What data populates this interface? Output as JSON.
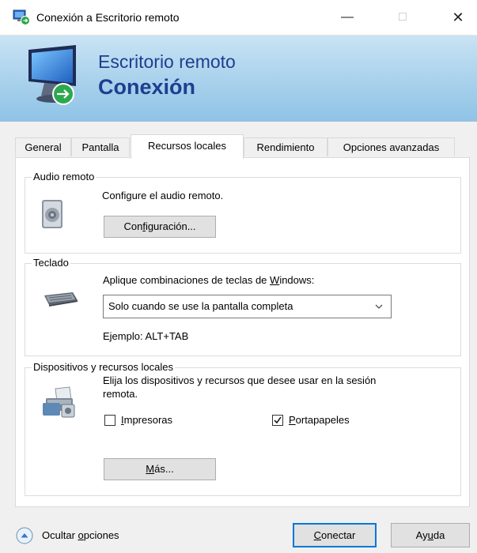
{
  "window": {
    "title": "Conexión a Escritorio remoto",
    "controls": {
      "minimize": "—",
      "maximize": "□",
      "close": "✕"
    }
  },
  "banner": {
    "line1": "Escritorio remoto",
    "line2": "Conexión"
  },
  "tabs": [
    {
      "label": "General",
      "active": false
    },
    {
      "label": "Pantalla",
      "active": false
    },
    {
      "label": "Recursos locales",
      "active": true
    },
    {
      "label": "Rendimiento",
      "active": false
    },
    {
      "label": "Opciones avanzadas",
      "active": false
    }
  ],
  "audio": {
    "group_label": "Audio remoto",
    "description": "Configure el audio remoto.",
    "button_pre": "Con",
    "button_mnemonic": "f",
    "button_post": "iguración..."
  },
  "keyboard": {
    "group_label": "Teclado",
    "description_pre": "Aplique combinaciones de teclas de ",
    "description_mnemonic": "W",
    "description_post": "indows:",
    "select_value": "Solo cuando se use la pantalla completa",
    "example": "Ejemplo: ALT+TAB"
  },
  "devices": {
    "group_label": "Dispositivos y recursos locales",
    "description_line1": "Elija los dispositivos y recursos que desee usar en la sesión",
    "description_line2": "remota.",
    "printers": {
      "mnemonic": "I",
      "rest": "mpresoras",
      "checked": false
    },
    "clipboard": {
      "mnemonic": "P",
      "rest": "ortapapeles",
      "checked": true
    },
    "more_button": {
      "mnemonic": "M",
      "rest": "ás..."
    }
  },
  "footer": {
    "hide_options_pre": "Ocultar ",
    "hide_options_mnemonic": "o",
    "hide_options_post": "pciones",
    "connect": {
      "mnemonic": "C",
      "rest": "onectar"
    },
    "help": {
      "pre": "Ay",
      "mnemonic": "u",
      "post": "da"
    }
  },
  "colors": {
    "accent": "#0078d7",
    "banner_text": "#1e3e8f",
    "panel_bg": "#ffffff",
    "window_bg": "#f0f0f0"
  }
}
